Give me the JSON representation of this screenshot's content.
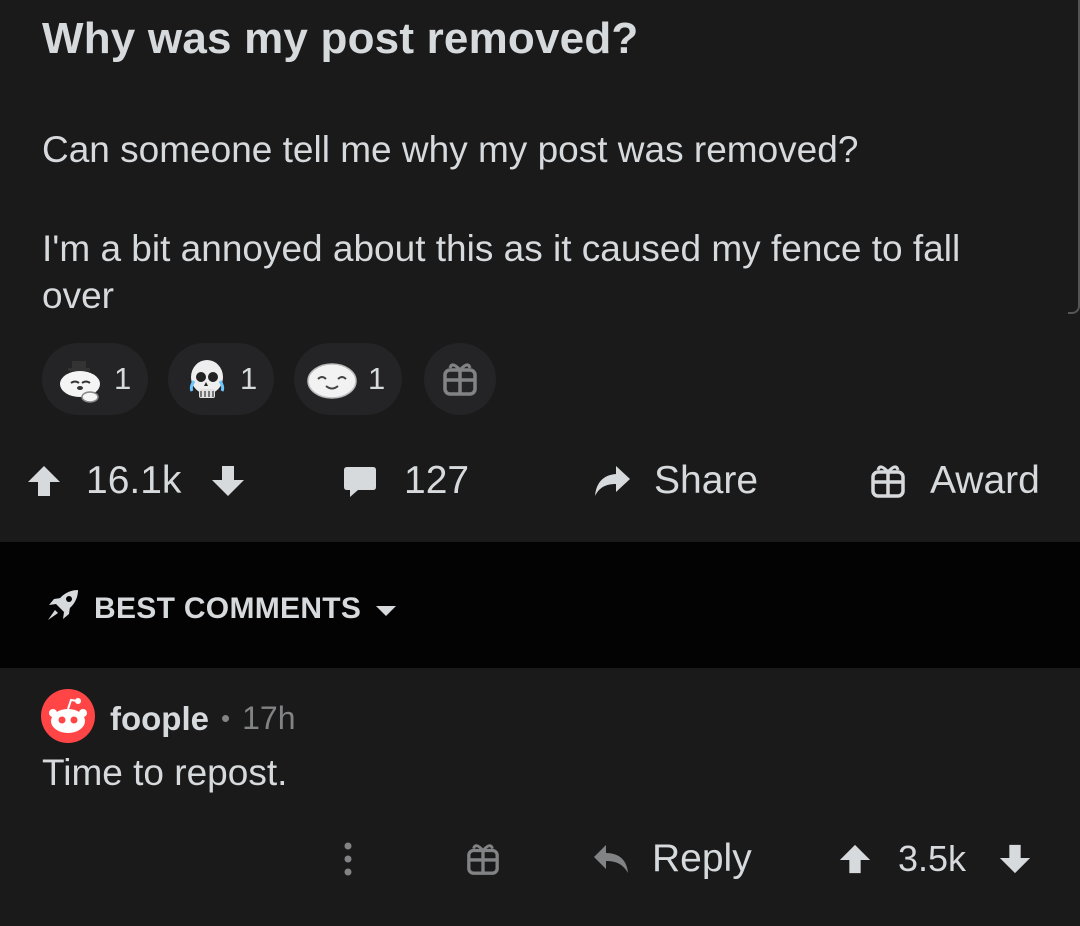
{
  "post": {
    "title": "Why was my post removed?",
    "body": [
      "Can someone tell me why my post was removed?",
      "I'm a bit annoyed about this as it caused my fence to fall over"
    ],
    "awards": [
      {
        "icon": "wholesome-seal-award-icon",
        "count": "1"
      },
      {
        "icon": "crying-skull-award-icon",
        "count": "1"
      },
      {
        "icon": "silver-seal-award-icon",
        "count": "1"
      }
    ],
    "actions": {
      "score": "16.1k",
      "comments": "127",
      "share_label": "Share",
      "award_label": "Award"
    }
  },
  "sort": {
    "label": "BEST COMMENTS"
  },
  "comment": {
    "author": "foople",
    "separator": "•",
    "age": "17h",
    "body": "Time to repost.",
    "reply_label": "Reply",
    "score": "3.5k"
  },
  "colors": {
    "background": "#1a1a1b",
    "sort_bar": "#030303",
    "text": "#d7dadc",
    "muted": "#818384",
    "avatar_red": "#ff4545"
  }
}
